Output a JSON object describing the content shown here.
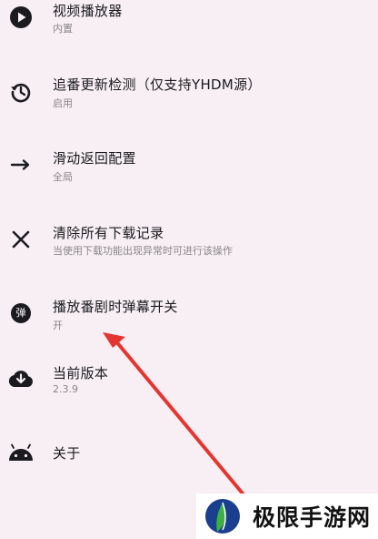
{
  "settings": [
    {
      "title": "视频播放器",
      "subtitle": "内置",
      "icon": "play-circle-icon"
    },
    {
      "title": "追番更新检测（仅支持YHDM源）",
      "subtitle": "启用",
      "icon": "history-refresh-icon"
    },
    {
      "title": "滑动返回配置",
      "subtitle": "全局",
      "icon": "arrow-right-icon"
    },
    {
      "title": "清除所有下载记录",
      "subtitle": "当使用下载功能出现异常时可进行该操作",
      "icon": "close-icon"
    },
    {
      "title": "播放番剧时弹幕开关",
      "subtitle": "开",
      "icon": "danmaku-badge-icon",
      "badge": "弹"
    },
    {
      "title": "当前版本",
      "subtitle": "2.3.9",
      "icon": "cloud-download-icon"
    },
    {
      "title": "关于",
      "subtitle": "",
      "icon": "android-icon"
    }
  ],
  "annotation": {
    "color": "#e53530"
  },
  "watermark": {
    "text": "极限手游网",
    "logo_colors": [
      "#1a3f8f",
      "#3cb043"
    ]
  }
}
